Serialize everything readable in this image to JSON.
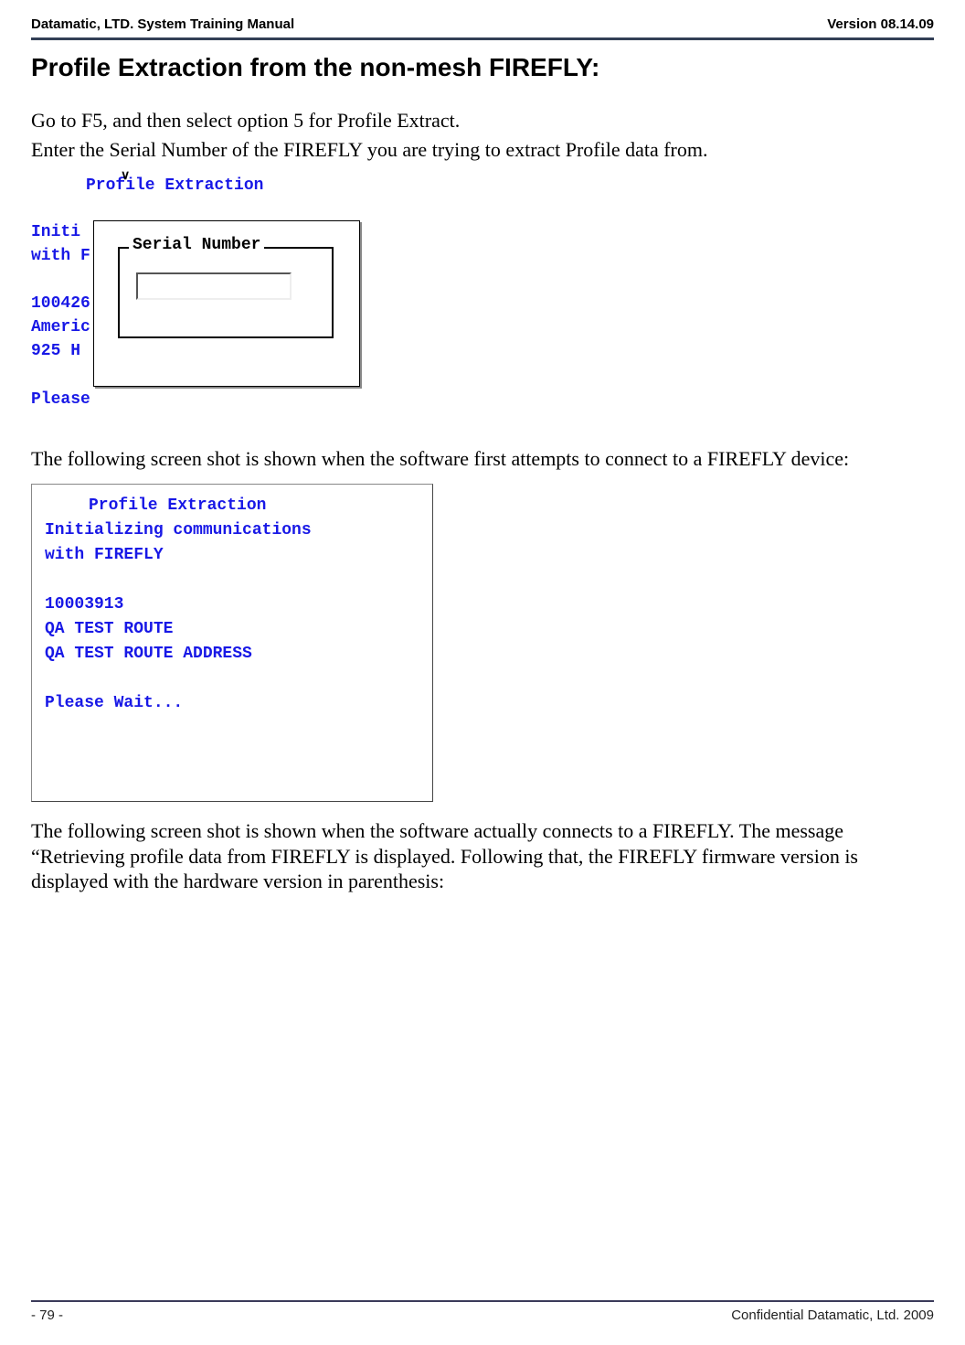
{
  "header": {
    "left": "Datamatic, LTD. System Training  Manual",
    "right": "Version 08.14.09"
  },
  "title": "Profile Extraction from the non-mesh FIREFLY:",
  "intro": {
    "line1": "Go to F5, and then select option 5 for Profile Extract.",
    "line2": "Enter the Serial Number of the FIREFLY you are trying to extract Profile data from."
  },
  "shot1": {
    "title": "Profile Extraction",
    "left_lines": "Initi\nwith F\n\n100426\nAmeric\n925 H\n\nPlease",
    "legend": "Serial Number",
    "input_value": ""
  },
  "mid_text": "The following screen shot is shown when the software first attempts to connect to a FIREFLY device:",
  "shot2": {
    "title": "Profile Extraction",
    "body": "\nInitializing communications\nwith FIREFLY\n\n10003913\nQA TEST ROUTE\nQA TEST ROUTE ADDRESS\n\nPlease Wait..."
  },
  "para2": "The following screen shot is shown when the software actually connects to a FIREFLY.  The message “Retrieving profile data from FIREFLY is displayed.  Following that, the FIREFLY firmware version is displayed with the hardware version in parenthesis:",
  "footer": {
    "left": "- 79 -",
    "right": "Confidential Datamatic, Ltd. 2009"
  }
}
